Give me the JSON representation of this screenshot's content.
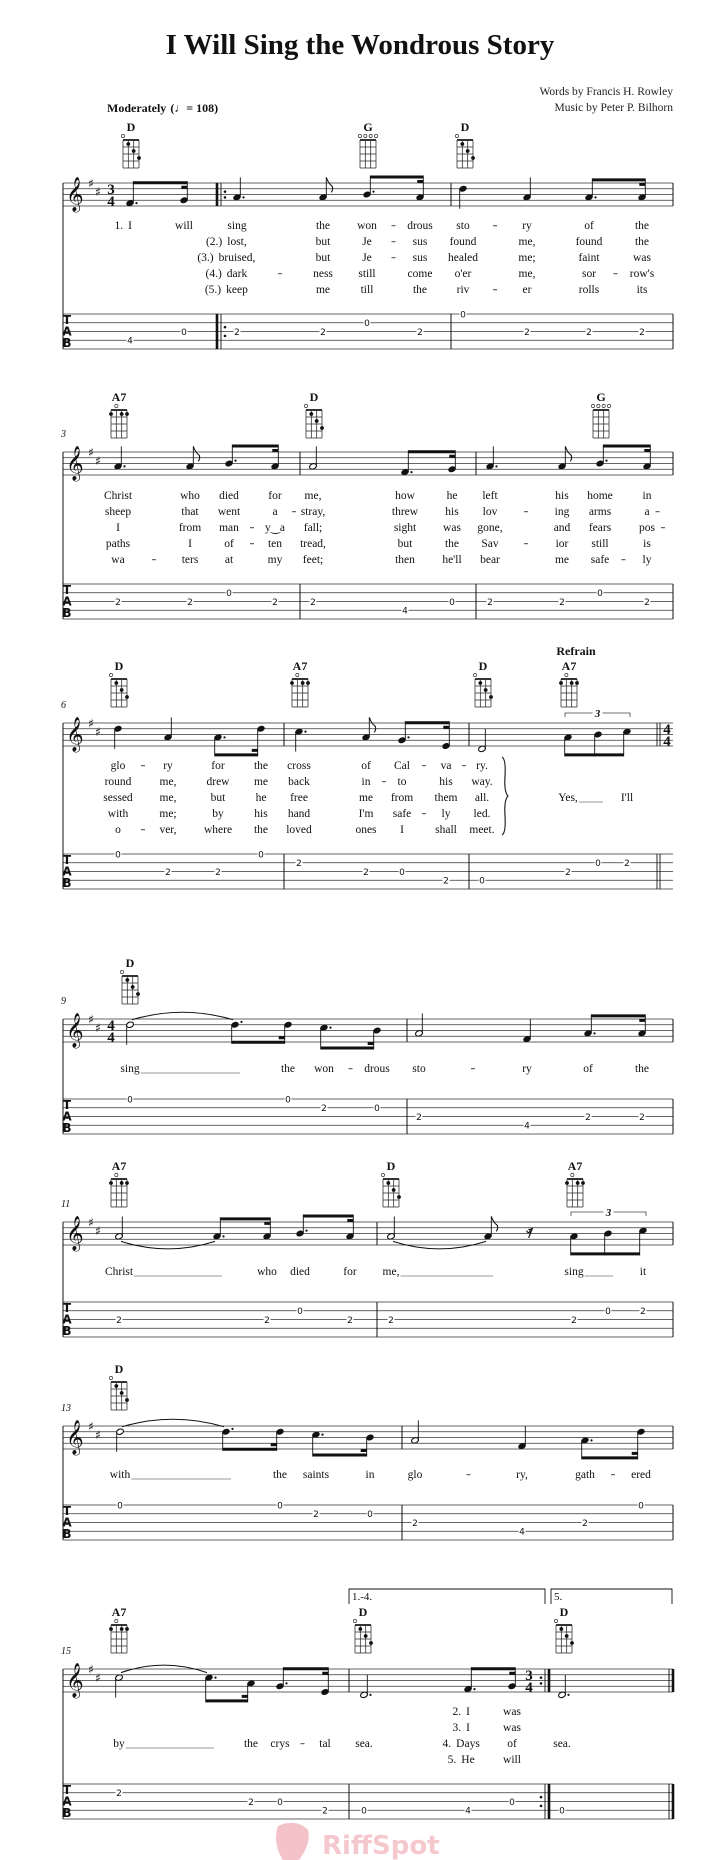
{
  "title": "I Will Sing the Wondrous Story",
  "credits": {
    "words": "Words by Francis H. Rowley",
    "music": "Music by Peter P. Bilhorn"
  },
  "tempo": {
    "label": "Moderately",
    "mark": "(♩= 108)"
  },
  "refrain_label": "Refrain",
  "tab_clef": [
    "T",
    "A",
    "B"
  ],
  "watermark": "RiffSpot",
  "colors": {
    "ink": "#111111",
    "staff": "#333333",
    "watermark": "#f4c3c9",
    "extender": "#777777"
  },
  "chords": {
    "D": {
      "open": [
        1
      ],
      "dots": [
        [
          2,
          1
        ],
        [
          3,
          2
        ],
        [
          4,
          3
        ]
      ]
    },
    "A7": {
      "open": [
        2
      ],
      "dots": [
        [
          1,
          1
        ],
        [
          3,
          1
        ],
        [
          4,
          1
        ]
      ]
    },
    "G": {
      "open": [
        1,
        2,
        3,
        4
      ],
      "dots": []
    }
  },
  "systems": [
    {
      "measure_number": "",
      "chords": [
        "D",
        "G",
        "D"
      ],
      "time_signature": [
        "3",
        "4"
      ],
      "events": [
        {
          "p": "F#4",
          "d": "8.",
          "s": 4,
          "f": "4"
        },
        {
          "p": "G4",
          "d": "16",
          "s": 3,
          "f": "0"
        },
        {
          "p": "A4",
          "d": "q.",
          "s": 3,
          "f": "2"
        },
        {
          "p": "A4",
          "d": "8",
          "s": 3,
          "f": "2"
        },
        {
          "p": "B4",
          "d": "8.",
          "s": 2,
          "f": "0"
        },
        {
          "p": "A4",
          "d": "16",
          "s": 3,
          "f": "2"
        },
        {
          "p": "D5",
          "d": "q",
          "s": 1,
          "f": "0"
        },
        {
          "p": "A4",
          "d": "q",
          "s": 3,
          "f": "2"
        },
        {
          "p": "A4",
          "d": "8.",
          "s": 3,
          "f": "2"
        },
        {
          "p": "A4",
          "d": "16",
          "s": 3,
          "f": "2"
        }
      ],
      "lyrics": [
        [
          {
            "label": "1.",
            "t": "I"
          },
          "will",
          "sing",
          "the",
          "won-",
          "drous",
          "sto-",
          "ry",
          "of",
          "the"
        ],
        [
          "",
          "",
          {
            "label": "(2.)",
            "t": "lost,"
          },
          "but",
          "Je-",
          "sus",
          "found",
          "me,",
          "found",
          "the"
        ],
        [
          "",
          "",
          {
            "label": "(3.)",
            "t": "bruised,"
          },
          "but",
          "Je-",
          "sus",
          "healed",
          "me;",
          "faint",
          "was"
        ],
        [
          "",
          "",
          {
            "label": "(4.)",
            "t": "dark-"
          },
          "ness",
          "still",
          "come",
          "o'er",
          "me,",
          "sor-",
          "row's"
        ],
        [
          "",
          "",
          {
            "label": "(5.)",
            "t": "keep"
          },
          "me",
          "till",
          "the",
          "riv-",
          "er",
          "rolls",
          "its"
        ]
      ]
    },
    {
      "measure_number": "3",
      "chords": [
        "A7",
        "D",
        "G"
      ],
      "events": [
        {
          "p": "A4",
          "d": "q.",
          "s": 3,
          "f": "2"
        },
        {
          "p": "A4",
          "d": "8",
          "s": 3,
          "f": "2"
        },
        {
          "p": "B4",
          "d": "8.",
          "s": 2,
          "f": "0"
        },
        {
          "p": "A4",
          "d": "16",
          "s": 3,
          "f": "2"
        },
        {
          "p": "A4",
          "d": "h",
          "s": 3,
          "f": "2"
        },
        {
          "p": "F#4",
          "d": "8.",
          "s": 4,
          "f": "4"
        },
        {
          "p": "G4",
          "d": "16",
          "s": 3,
          "f": "0"
        },
        {
          "p": "A4",
          "d": "q.",
          "s": 3,
          "f": "2"
        },
        {
          "p": "A4",
          "d": "8",
          "s": 3,
          "f": "2"
        },
        {
          "p": "B4",
          "d": "8.",
          "s": 2,
          "f": "0"
        },
        {
          "p": "A4",
          "d": "16",
          "s": 3,
          "f": "2"
        }
      ],
      "lyrics": [
        [
          "Christ",
          "who",
          "died",
          "for",
          "me,",
          "how",
          "he",
          "left",
          "his",
          "home",
          "in"
        ],
        [
          "sheep",
          "that",
          "went",
          "a-",
          "stray,",
          "threw",
          "his",
          "lov-",
          "ing",
          "arms",
          "a-"
        ],
        [
          "I",
          "from",
          "man-",
          "y‿a",
          "fall;",
          "sight",
          "was",
          "gone,",
          "and",
          "fears",
          "pos-"
        ],
        [
          "paths",
          "I",
          "of-",
          "ten",
          "tread,",
          "but",
          "the",
          "Sav-",
          "ior",
          "still",
          "is"
        ],
        [
          "wa-",
          "ters",
          "at",
          "my",
          "feet;",
          "then",
          "he'll",
          "bear",
          "me",
          "safe-",
          "ly"
        ]
      ]
    },
    {
      "measure_number": "6",
      "chords": [
        "D",
        "A7",
        "D",
        "A7"
      ],
      "end_time_signature": [
        "4",
        "4"
      ],
      "tuplet": "3",
      "events": [
        {
          "p": "D5",
          "d": "q",
          "s": 1,
          "f": "0"
        },
        {
          "p": "A4",
          "d": "q",
          "s": 3,
          "f": "2"
        },
        {
          "p": "A4",
          "d": "8.",
          "s": 3,
          "f": "2"
        },
        {
          "p": "D5",
          "d": "16",
          "s": 1,
          "f": "0"
        },
        {
          "p": "C#5",
          "d": "q.",
          "s": 2,
          "f": "2"
        },
        {
          "p": "A4",
          "d": "8",
          "s": 3,
          "f": "2"
        },
        {
          "p": "G4",
          "d": "8.",
          "s": 3,
          "f": "0"
        },
        {
          "p": "E4",
          "d": "16",
          "s": 4,
          "f": "2"
        },
        {
          "p": "D4",
          "d": "h",
          "s": 4,
          "f": "0"
        },
        {
          "p": "A4",
          "d": "8",
          "tup": true,
          "s": 3,
          "f": "2"
        },
        {
          "p": "B4",
          "d": "8",
          "tup": true,
          "s": 2,
          "f": "0"
        },
        {
          "p": "C#5",
          "d": "8",
          "tup": true,
          "s": 2,
          "f": "2"
        }
      ],
      "lyrics": [
        [
          "glo-",
          "ry",
          "for",
          "the",
          "cross",
          "of",
          "Cal-",
          "va-",
          "ry."
        ],
        [
          "round",
          "me,",
          "drew",
          "me",
          "back",
          "in-",
          "to",
          "his",
          "way."
        ],
        [
          "sessed",
          "me,",
          "but",
          "he",
          "free",
          "me",
          "from",
          "them",
          "all.",
          "Yes,_",
          "",
          "I'll"
        ],
        [
          "with",
          "me;",
          "by",
          "his",
          "hand",
          "I'm",
          "safe-",
          "ly",
          "led."
        ],
        [
          "o-",
          "ver,",
          "where",
          "the",
          "loved",
          "ones",
          "I",
          "shall",
          "meet."
        ]
      ]
    },
    {
      "measure_number": "9",
      "chords": [
        "D"
      ],
      "time_signature": [
        "4",
        "4"
      ],
      "events": [
        {
          "p": "D5",
          "d": "h",
          "tie": true,
          "s": 1,
          "f": "0"
        },
        {
          "p": "D5",
          "d": "8."
        },
        {
          "p": "D5",
          "d": "16",
          "s": 1,
          "f": "0"
        },
        {
          "p": "C#5",
          "d": "8.",
          "s": 2,
          "f": "2"
        },
        {
          "p": "B4",
          "d": "16",
          "s": 2,
          "f": "0"
        },
        {
          "p": "A4",
          "d": "h",
          "s": 3,
          "f": "2"
        },
        {
          "p": "F#4",
          "d": "q",
          "s": 4,
          "f": "4"
        },
        {
          "p": "A4",
          "d": "8.",
          "s": 3,
          "f": "2"
        },
        {
          "p": "A4",
          "d": "16",
          "s": 3,
          "f": "2"
        }
      ],
      "lyrics": [
        [
          "sing_",
          "",
          "the",
          "won-",
          "drous",
          "sto-",
          "ry",
          "of",
          "the"
        ]
      ]
    },
    {
      "measure_number": "11",
      "chords": [
        "A7",
        "D",
        "A7"
      ],
      "tuplet": "3",
      "events": [
        {
          "p": "A4",
          "d": "h",
          "tie": true,
          "s": 3,
          "f": "2"
        },
        {
          "p": "A4",
          "d": "8."
        },
        {
          "p": "A4",
          "d": "16",
          "s": 3,
          "f": "2"
        },
        {
          "p": "B4",
          "d": "8.",
          "s": 2,
          "f": "0"
        },
        {
          "p": "A4",
          "d": "16",
          "s": 3,
          "f": "2"
        },
        {
          "p": "A4",
          "d": "h",
          "tie": true,
          "s": 3,
          "f": "2"
        },
        {
          "p": "A4",
          "d": "8"
        },
        {
          "p": "rest",
          "d": "r8"
        },
        {
          "p": "A4",
          "d": "8",
          "tup": true,
          "s": 3,
          "f": "2"
        },
        {
          "p": "B4",
          "d": "8",
          "tup": true,
          "s": 2,
          "f": "0"
        },
        {
          "p": "C#5",
          "d": "8",
          "tup": true,
          "s": 2,
          "f": "2"
        }
      ],
      "lyrics": [
        [
          "Christ_",
          "",
          "who",
          "died",
          "for",
          "me,_",
          "",
          "",
          "sing_",
          "",
          "it"
        ]
      ]
    },
    {
      "measure_number": "13",
      "chords": [
        "D"
      ],
      "events": [
        {
          "p": "D5",
          "d": "h",
          "tie": true,
          "s": 1,
          "f": "0"
        },
        {
          "p": "D5",
          "d": "8."
        },
        {
          "p": "D5",
          "d": "16",
          "s": 1,
          "f": "0"
        },
        {
          "p": "C#5",
          "d": "8.",
          "s": 2,
          "f": "2"
        },
        {
          "p": "B4",
          "d": "16",
          "s": 2,
          "f": "0"
        },
        {
          "p": "A4",
          "d": "h",
          "s": 3,
          "f": "2"
        },
        {
          "p": "F#4",
          "d": "q",
          "s": 4,
          "f": "4"
        },
        {
          "p": "A4",
          "d": "8.",
          "s": 3,
          "f": "2"
        },
        {
          "p": "D5",
          "d": "16",
          "s": 1,
          "f": "0"
        }
      ],
      "lyrics": [
        [
          "with_",
          "",
          "the",
          "saints",
          "in",
          "glo-",
          "ry,",
          "gath-",
          "ered"
        ]
      ]
    },
    {
      "measure_number": "15",
      "chords": [
        "A7",
        "D",
        "D"
      ],
      "mid_time_signature": [
        "3",
        "4"
      ],
      "voltas": [
        "1.-4.",
        "5."
      ],
      "events": [
        {
          "p": "C#5",
          "d": "h",
          "tie": true,
          "s": 2,
          "f": "2"
        },
        {
          "p": "C#5",
          "d": "8."
        },
        {
          "p": "A4",
          "d": "16",
          "s": 3,
          "f": "2"
        },
        {
          "p": "G4",
          "d": "8.",
          "s": 3,
          "f": "0"
        },
        {
          "p": "E4",
          "d": "16",
          "s": 4,
          "f": "2"
        },
        {
          "p": "D4",
          "d": "h.",
          "s": 4,
          "f": "0"
        },
        {
          "p": "F#4",
          "d": "8.",
          "s": 4,
          "f": "4"
        },
        {
          "p": "G4",
          "d": "16",
          "s": 3,
          "f": "0"
        },
        {
          "p": "D4",
          "d": "h.",
          "s": 4,
          "f": "0"
        }
      ],
      "lyrics": [
        [
          "",
          "",
          "",
          "",
          "",
          "",
          {
            "label": "2.",
            "t": "I"
          },
          "was",
          ""
        ],
        [
          "",
          "",
          "",
          "",
          "",
          "",
          {
            "label": "3.",
            "t": "I"
          },
          "was",
          ""
        ],
        [
          "by_",
          "",
          "the",
          "crys-",
          "tal",
          "sea.",
          {
            "label": "4.",
            "t": "Days"
          },
          "of",
          "sea."
        ],
        [
          "",
          "",
          "",
          "",
          "",
          "",
          {
            "label": "5.",
            "t": "He"
          },
          "will",
          ""
        ]
      ]
    }
  ]
}
